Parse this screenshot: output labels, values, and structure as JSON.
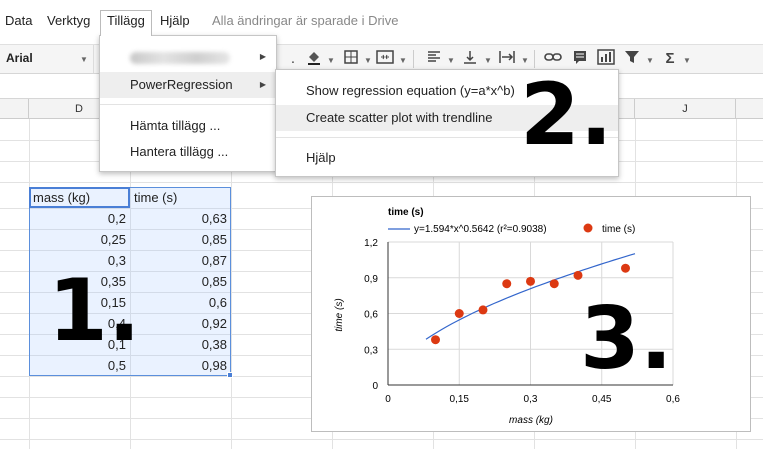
{
  "menubar": {
    "items": [
      "Data",
      "Verktyg",
      "Tillägg",
      "Hjälp"
    ],
    "saved_status": "Alla ändringar är sparade i Drive"
  },
  "toolbar": {
    "font": "Arial",
    "icons": [
      "paint-bucket-icon",
      "borders-icon",
      "merge-cells-icon",
      "align-left-icon",
      "vertical-align-icon",
      "text-wrap-icon",
      "link-icon",
      "comment-icon",
      "insert-chart-icon",
      "filter-icon",
      "functions-icon"
    ]
  },
  "grid": {
    "column_d": "D",
    "column_j": "J"
  },
  "table": {
    "headers": [
      "mass (kg)",
      "time (s)"
    ],
    "rows": [
      [
        "0,2",
        "0,63"
      ],
      [
        "0,25",
        "0,85"
      ],
      [
        "0,3",
        "0,87"
      ],
      [
        "0,35",
        "0,85"
      ],
      [
        "0,15",
        "0,6"
      ],
      [
        "0,4",
        "0,92"
      ],
      [
        "0,1",
        "0,38"
      ],
      [
        "0,5",
        "0,98"
      ]
    ]
  },
  "addons_menu": {
    "power_regression": "PowerRegression",
    "get_addons": "Hämta tillägg ...",
    "manage_addons": "Hantera tillägg ..."
  },
  "power_regression_menu": {
    "show_equation": "Show regression equation (y=a*x^b)",
    "create_plot": "Create scatter plot with trendline",
    "help": "Hjälp"
  },
  "annotations": [
    "1.",
    "2.",
    "3."
  ],
  "colors": {
    "point": "#dc3912",
    "trendline": "#3366cc",
    "selection": "#4a7fd6"
  },
  "chart_data": {
    "type": "scatter",
    "title": "time (s)",
    "xlabel": "mass (kg)",
    "ylabel": "time (s)",
    "xlim": [
      0,
      0.6
    ],
    "ylim": [
      0,
      1.2
    ],
    "x_ticks": [
      "0",
      "0,15",
      "0,3",
      "0,45",
      "0,6"
    ],
    "y_ticks": [
      "0",
      "0,3",
      "0,6",
      "0,9",
      "1,2"
    ],
    "legend_position": "top",
    "series": [
      {
        "name": "time (s)",
        "type": "scatter",
        "x": [
          0.2,
          0.25,
          0.3,
          0.35,
          0.15,
          0.4,
          0.1,
          0.5
        ],
        "y": [
          0.63,
          0.85,
          0.87,
          0.85,
          0.6,
          0.92,
          0.38,
          0.98
        ]
      },
      {
        "name": "y=1.594*x^0.5642 (r²=0.9038)",
        "type": "trendline",
        "a": 1.594,
        "b": 0.5642,
        "x_range": [
          0.08,
          0.52
        ]
      }
    ]
  }
}
